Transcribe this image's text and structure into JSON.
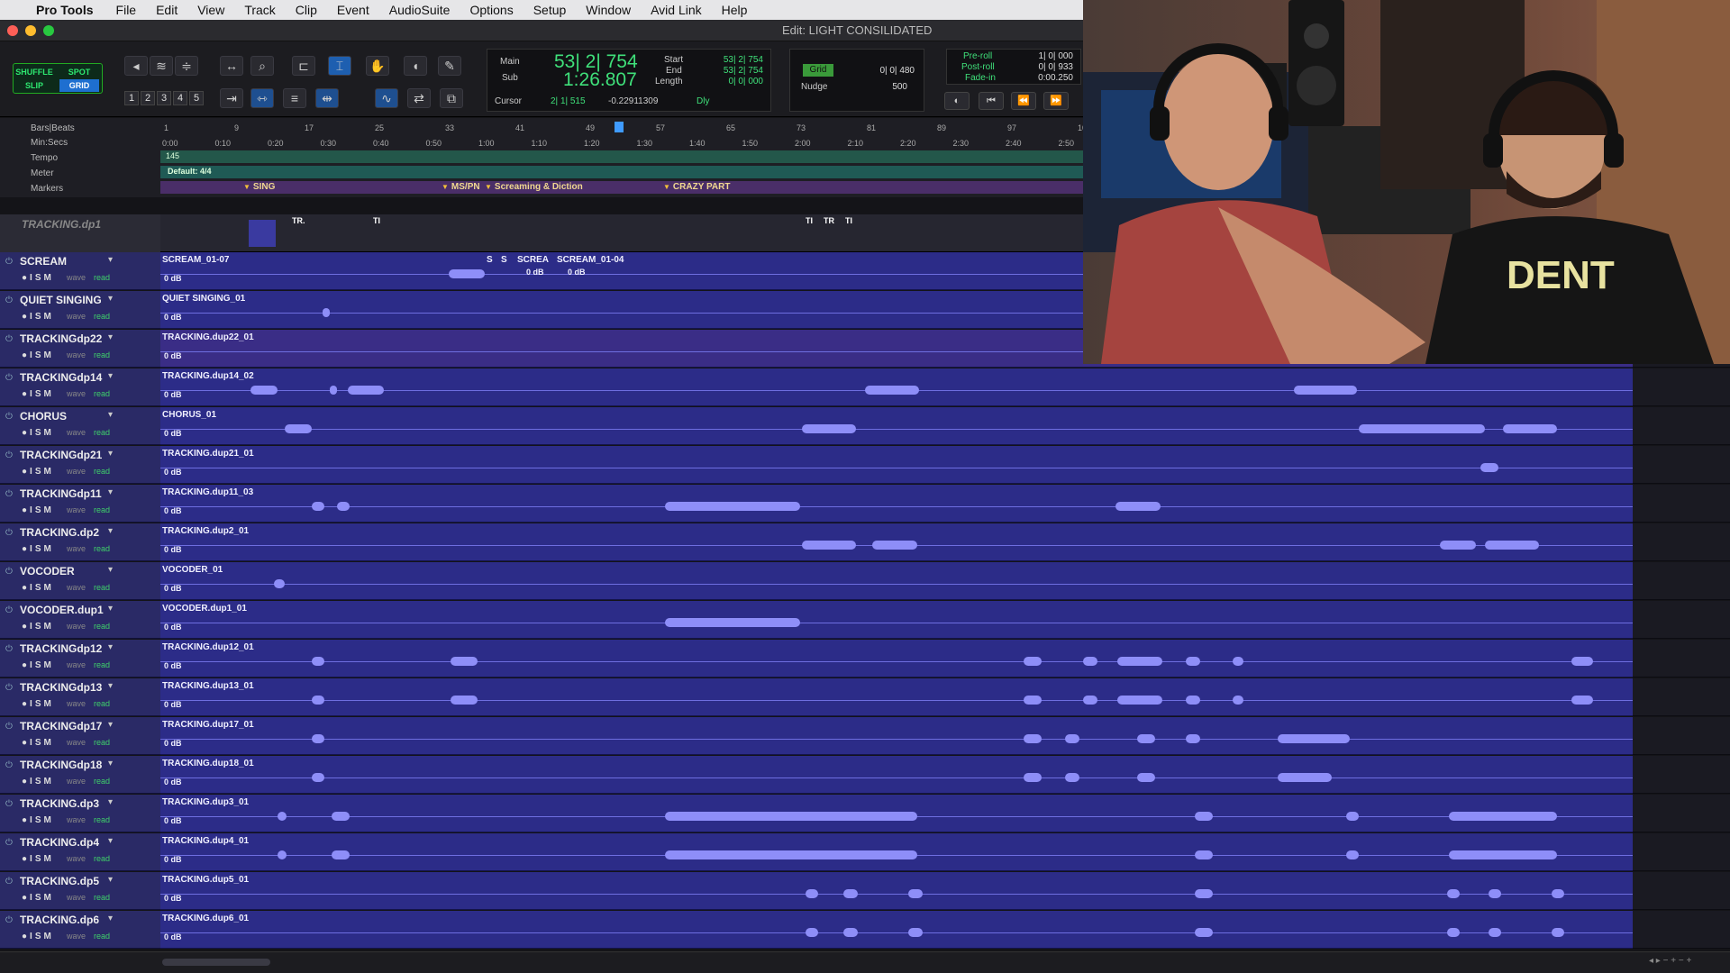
{
  "menubar": {
    "app": "Pro Tools",
    "items": [
      "File",
      "Edit",
      "View",
      "Track",
      "Clip",
      "Event",
      "AudioSuite",
      "Options",
      "Setup",
      "Window",
      "Avid Link",
      "Help"
    ]
  },
  "window": {
    "title": "Edit: LIGHT CONSILIDATED"
  },
  "modes": {
    "shuffle": "SHUFFLE",
    "spot": "SPOT",
    "slip": "SLIP",
    "grid": "GRID"
  },
  "zoom_presets": [
    "1",
    "2",
    "3",
    "4",
    "5"
  ],
  "counter": {
    "main_label": "Main",
    "sub_label": "Sub",
    "main": "53| 2| 754",
    "sub": "1:26.807",
    "start_label": "Start",
    "end_label": "End",
    "length_label": "Length",
    "start": "53| 2| 754",
    "end": "53| 2| 754",
    "length": "0| 0| 000",
    "cursor_label": "Cursor",
    "cursor": "2| 1| 515",
    "cursor_val": "-0.22911309",
    "dly": "Dly"
  },
  "grid": {
    "label": "Grid",
    "value": "0| 0| 480",
    "nudge_label": "Nudge",
    "nudge": "500"
  },
  "preroll": {
    "pre_label": "Pre-roll",
    "post_label": "Post-roll",
    "fade_label": "Fade-in",
    "pre": "1| 0| 000",
    "post": "0| 0| 933",
    "fade": "0:00.250"
  },
  "rulers": {
    "bars_label": "Bars|Beats",
    "min_label": "Min:Secs",
    "tempo_label": "Tempo",
    "meter_label": "Meter",
    "markers_label": "Markers",
    "bars": [
      "1",
      "9",
      "17",
      "25",
      "33",
      "41",
      "49",
      "57",
      "65",
      "73",
      "81",
      "89",
      "97",
      "10"
    ],
    "mins": [
      "0:00",
      "0:10",
      "0:20",
      "0:30",
      "0:40",
      "0:50",
      "1:00",
      "1:10",
      "1:20",
      "1:30",
      "1:40",
      "1:50",
      "2:00",
      "2:10",
      "2:20",
      "2:30",
      "2:40",
      "2:50"
    ],
    "tempo": "145",
    "meter": "Default: 4/4",
    "markers": [
      "SING",
      "MS/PN",
      "Screaming & Diction",
      "CRAZY PART"
    ]
  },
  "folder_track": {
    "name": "TRACKING.dp1",
    "clips": [
      "TR.",
      "TI",
      "TI",
      "TR",
      "TI"
    ]
  },
  "track_buttons": {
    "rec": "●",
    "input": "I",
    "solo": "S",
    "mute": "M",
    "view": "wave",
    "auto": "read"
  },
  "tracks": [
    {
      "name": "SCREAM",
      "clip": "SCREAM_01-07",
      "gain": "0 dB",
      "extra_clips": [
        "S",
        "S",
        "SCREA",
        "SCREAM_01-04"
      ],
      "extra_gains": [
        "0 dB",
        "0 dB"
      ]
    },
    {
      "name": "QUIET SINGING",
      "clip": "QUIET SINGING_01",
      "gain": "0 dB"
    },
    {
      "name": "TRACKINGdp22",
      "clip": "TRACKING.dup22_01",
      "gain": "0 dB"
    },
    {
      "name": "TRACKINGdp14",
      "clip": "TRACKING.dup14_02",
      "gain": "0 dB"
    },
    {
      "name": "CHORUS",
      "clip": "CHORUS_01",
      "gain": "0 dB"
    },
    {
      "name": "TRACKINGdp21",
      "clip": "TRACKING.dup21_01",
      "gain": "0 dB"
    },
    {
      "name": "TRACKINGdp11",
      "clip": "TRACKING.dup11_03",
      "gain": "0 dB"
    },
    {
      "name": "TRACKING.dp2",
      "clip": "TRACKING.dup2_01",
      "gain": "0 dB"
    },
    {
      "name": "VOCODER",
      "clip": "VOCODER_01",
      "gain": "0 dB"
    },
    {
      "name": "VOCODER.dup1",
      "clip": "VOCODER.dup1_01",
      "gain": "0 dB"
    },
    {
      "name": "TRACKINGdp12",
      "clip": "TRACKING.dup12_01",
      "gain": "0 dB"
    },
    {
      "name": "TRACKINGdp13",
      "clip": "TRACKING.dup13_01",
      "gain": "0 dB"
    },
    {
      "name": "TRACKINGdp17",
      "clip": "TRACKING.dup17_01",
      "gain": "0 dB"
    },
    {
      "name": "TRACKINGdp18",
      "clip": "TRACKING.dup18_01",
      "gain": "0 dB"
    },
    {
      "name": "TRACKING.dp3",
      "clip": "TRACKING.dup3_01",
      "gain": "0 dB"
    },
    {
      "name": "TRACKING.dp4",
      "clip": "TRACKING.dup4_01",
      "gain": "0 dB"
    },
    {
      "name": "TRACKING.dp5",
      "clip": "TRACKING.dup5_01",
      "gain": "0 dB"
    },
    {
      "name": "TRACKING.dp6",
      "clip": "TRACKING.dup6_01",
      "gain": "0 dB"
    }
  ],
  "webcam": {
    "shirt_text": "DENT"
  },
  "colors": {
    "track_header": "#2a2a66",
    "track_lane": "#2c2c88",
    "waveform": "#8e8ef8",
    "counter_green": "#3fe07a"
  }
}
